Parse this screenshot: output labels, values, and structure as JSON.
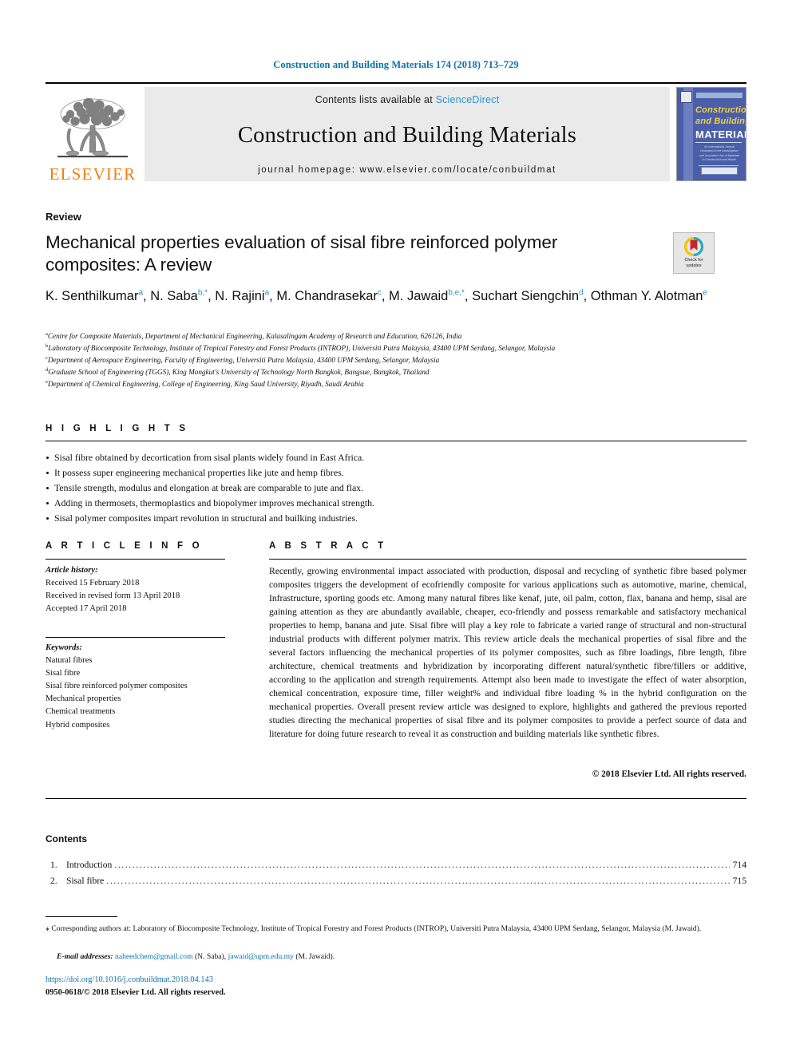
{
  "running_head": "Construction and Building Materials 174 (2018) 713–729",
  "masthead": {
    "publisher_name": "ELSEVIER",
    "contents_prefix": "Contents lists available at",
    "contents_link": "ScienceDirect",
    "journal_name": "Construction and Building Materials",
    "homepage": "journal homepage: www.elsevier.com/locate/conbuildmat",
    "cover": {
      "line1": "Construction",
      "line2": "and Building",
      "line3": "MATERIALS",
      "blurb": "An International Journal Dedicated to the Investigation and Innovative Use of Materials in Construction and Repair"
    }
  },
  "article": {
    "type_label": "Review",
    "title": "Mechanical properties evaluation of sisal fibre reinforced polymer composites: A review",
    "crossmark": {
      "line1": "Check for",
      "line2": "updates"
    },
    "authors_html": "K. Senthilkumar<sup>a</sup>, N. Saba<sup>b,*</sup>, N. Rajini<sup>a</sup>, M. Chandrasekar<sup>c</sup>, M. Jawaid<sup>b,e,*</sup>, Suchart Siengchin<sup>d</sup>, Othman Y. Alotman<sup>e</sup>",
    "affiliations": [
      {
        "mark": "a",
        "text": "Centre for Composite Materials, Department of Mechanical Engineering, Kalasalingam Academy of Research and Education, 626126, India"
      },
      {
        "mark": "b",
        "text": "Laboratory of Biocomposite Technology, Institute of Tropical Forestry and Forest Products (INTROP), Universiti Putra Malaysia, 43400 UPM Serdang, Selangor, Malaysia"
      },
      {
        "mark": "c",
        "text": "Department of Aerospace Engineering, Faculty of Engineering, Universiti Putra Malaysia, 43400 UPM Serdang, Selangor, Malaysia"
      },
      {
        "mark": "d",
        "text": "Graduate School of Engineering (TGGS), King Mongkut's University of Technology North Bangkok, Bangsue, Bangkok, Thailand"
      },
      {
        "mark": "e",
        "text": "Department of Chemical Engineering, College of Engineering, King Saud University, Riyadh, Saudi Arabia"
      }
    ]
  },
  "highlights": {
    "heading": "H I G H L I G H T S",
    "items": [
      "Sisal fibre obtained by decortication from sisal plants widely found in East Africa.",
      "It possess super engineering mechanical properties like jute and hemp fibres.",
      "Tensile strength, modulus and elongation at break are comparable to jute and flax.",
      "Adding in thermosets, thermoplastics and biopolymer improves mechanical strength.",
      "Sisal polymer composites impart revolution in structural and builking industries."
    ]
  },
  "article_info": {
    "heading": "A R T I C L E    I N F O",
    "history_title": "Article history:",
    "history": [
      "Received 15 February 2018",
      "Received in revised form 13 April 2018",
      "Accepted 17 April 2018"
    ],
    "keywords_title": "Keywords:",
    "keywords": [
      "Natural fibres",
      "Sisal fibre",
      "Sisal fibre reinforced polymer composites",
      "Mechanical properties",
      "Chemical treatments",
      "Hybrid composites"
    ]
  },
  "abstract": {
    "heading": "A B S T R A C T",
    "text": "Recently, growing environmental impact associated with production, disposal and recycling of synthetic fibre based polymer composites triggers the development of ecofriendly composite for various applications such as automotive, marine, chemical, Infrastructure, sporting goods etc. Among many natural fibres like kenaf, jute, oil palm, cotton, flax, banana and hemp, sisal are gaining attention as they are abundantly available, cheaper, eco-friendly and possess remarkable and satisfactory mechanical properties to hemp, banana and jute. Sisal fibre will play a key role to fabricate a varied range of structural and non-structural industrial products with different polymer matrix. This review article deals the mechanical properties of sisal fibre and the several factors influencing the mechanical properties of its polymer composites, such as fibre loadings, fibre length, fibre architecture, chemical treatments and hybridization by incorporating different natural/synthetic fibre/fillers or additive, according to the application and strength requirements. Attempt also been made to investigate the effect of water absorption, chemical concentration, exposure time, filler weight% and individual fibre loading % in the hybrid configuration on the mechanical properties. Overall present review article was designed to explore, highlights and gathered the previous reported studies directing the mechanical properties of sisal fibre and its polymer composites to provide a perfect source of data and literature for doing future research to reveal it as construction and building materials like synthetic fibres.",
    "copyright": "© 2018 Elsevier Ltd. All rights reserved."
  },
  "contents": {
    "heading": "Contents",
    "entries": [
      {
        "num": "1.",
        "label": "Introduction",
        "page": "714"
      },
      {
        "num": "2.",
        "label": "Sisal fibre",
        "page": "715"
      }
    ]
  },
  "footnotes": {
    "corresponding": "Corresponding authors at: Laboratory of Biocomposite Technology, Institute of Tropical Forestry and Forest Products (INTROP), Universiti Putra Malaysia, 43400 UPM Serdang, Selangor, Malaysia (M. Jawaid).",
    "email_label": "E-mail addresses:",
    "email1": "naheedchem@gmail.com",
    "email1_who": "(N. Saba),",
    "email2": "jawaid@upm.edu.my",
    "email2_who": "(M. Jawaid).",
    "doi": "https://doi.org/10.1016/j.conbuildmat.2018.04.143",
    "issn": "0950-0618/© 2018 Elsevier Ltd. All rights reserved."
  },
  "colors": {
    "link_blue": "#0a72ad",
    "sd_blue": "#2a93c9",
    "elsevier_orange": "#f07f13",
    "cover_blue": "#4b5fa8",
    "cover_yellow": "#f2d03a"
  }
}
